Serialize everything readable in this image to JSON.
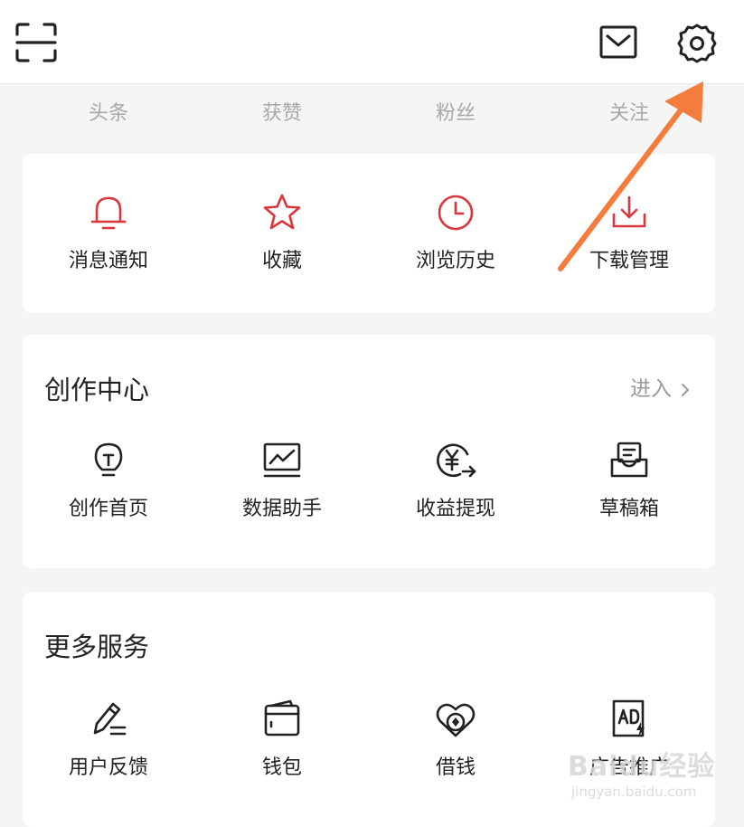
{
  "header": {
    "scan_icon": "scan-icon",
    "mail_icon": "mail-icon",
    "settings_icon": "gear-icon"
  },
  "stats": [
    "头条",
    "获赞",
    "粉丝",
    "关注"
  ],
  "quick_actions": [
    {
      "label": "消息通知",
      "icon": "bell-icon"
    },
    {
      "label": "收藏",
      "icon": "star-icon"
    },
    {
      "label": "浏览历史",
      "icon": "clock-icon"
    },
    {
      "label": "下载管理",
      "icon": "download-icon"
    }
  ],
  "creator_center": {
    "title": "创作中心",
    "enter_label": "进入",
    "items": [
      {
        "label": "创作首页",
        "icon": "lightbulb-icon"
      },
      {
        "label": "数据助手",
        "icon": "chart-monitor-icon"
      },
      {
        "label": "收益提现",
        "icon": "yuan-withdraw-icon"
      },
      {
        "label": "草稿箱",
        "icon": "draft-box-icon"
      }
    ]
  },
  "more_services": {
    "title": "更多服务",
    "items": [
      {
        "label": "用户反馈",
        "icon": "pen-icon"
      },
      {
        "label": "钱包",
        "icon": "wallet-icon"
      },
      {
        "label": "借钱",
        "icon": "heart-coin-icon"
      },
      {
        "label": "广告推广",
        "icon": "ad-icon"
      }
    ]
  },
  "annotation": {
    "color": "#f47c3c",
    "target": "gear-icon"
  },
  "watermark": {
    "main": "Baidu经验",
    "sub": "jingyan.baidu.com"
  },
  "colors": {
    "accent_red": "#d9363e",
    "text": "#222222",
    "muted": "#a8a8a8"
  }
}
